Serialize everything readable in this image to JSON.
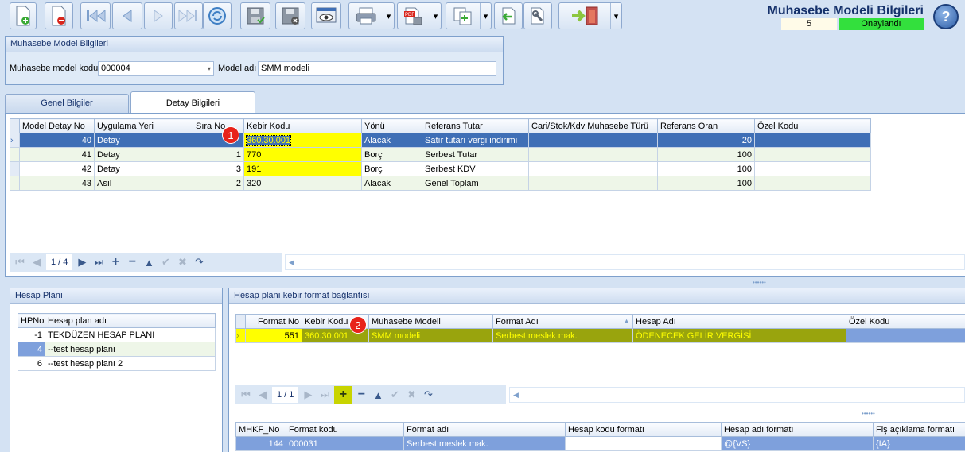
{
  "header": {
    "title": "Muhasebe Modeli Bilgileri",
    "record_id": "5",
    "status": "Onaylandı",
    "status_color": "#33e03d"
  },
  "toolbar": {
    "buttons": [
      "new-doc-icon",
      "delete-doc-icon",
      "first-record-icon",
      "previous-record-icon",
      "next-record-icon",
      "last-record-icon",
      "refresh-icon",
      "save-approve-icon",
      "save-cancel-icon",
      "preview-icon",
      "print-icon",
      "pdf-export-icon",
      "copy-icon",
      "import-icon",
      "tools-icon",
      "exit-icon"
    ]
  },
  "model_info": {
    "group_title": "Muhasebe Model Bilgileri",
    "code_label": "Muhasebe model kodu",
    "code_value": "000004",
    "name_label": "Model adı",
    "name_value": "SMM modeli"
  },
  "tabs": [
    "Genel Bilgiler",
    "Detay Bilgileri"
  ],
  "detail_grid": {
    "columns": [
      "Model Detay No",
      "Uygulama Yeri",
      "Sıra No",
      "Kebir Kodu",
      "Yönü",
      "Referans Tutar",
      "Cari/Stok/Kdv Muhasebe Türü",
      "Referans Oran",
      "Özel Kodu"
    ],
    "rows": [
      [
        "40",
        "Detay",
        "",
        "360.30.001",
        "Alacak",
        "Satır tutarı vergi indirimi",
        "",
        "20",
        ""
      ],
      [
        "41",
        "Detay",
        "1",
        "770",
        "Borç",
        "Serbest Tutar",
        "",
        "100",
        ""
      ],
      [
        "42",
        "Detay",
        "3",
        "191",
        "Borç",
        "Serbest KDV",
        "",
        "100",
        ""
      ],
      [
        "43",
        "Asıl",
        "2",
        "320",
        "Alacak",
        "Genel Toplam",
        "",
        "100",
        ""
      ]
    ],
    "nav_text": "1 / 4"
  },
  "hesap_plani": {
    "title": "Hesap Planı",
    "columns": [
      "HPNo",
      "Hesap plan adı"
    ],
    "rows": [
      [
        "-1",
        "TEKDÜZEN HESAP PLANI"
      ],
      [
        "4",
        "--test hesap planı"
      ],
      [
        "6",
        "--test hesap planı 2"
      ]
    ]
  },
  "format_link": {
    "title": "Hesap planı kebir format bağlantısı",
    "columns": [
      "Format No",
      "Kebir Kodu",
      "Muhasebe Modeli",
      "Format Adı",
      "Hesap Adı",
      "Özel Kodu"
    ],
    "rows": [
      [
        "551",
        "360.30.001",
        "SMM modeli",
        "Serbest meslek mak.",
        "ÖDENECEK GELİR VERGİSİ",
        ""
      ]
    ],
    "nav_text": "1 / 1"
  },
  "mhkf_grid": {
    "columns": [
      "MHKF_No",
      "Format kodu",
      "Format adı",
      "Hesap kodu formatı",
      "Hesap adı formatı",
      "Fiş açıklama formatı"
    ],
    "rows": [
      [
        "144",
        "000031",
        "Serbest meslek mak.",
        "",
        "@{VS}",
        "{IA}"
      ]
    ]
  },
  "badges": [
    "1",
    "2"
  ]
}
